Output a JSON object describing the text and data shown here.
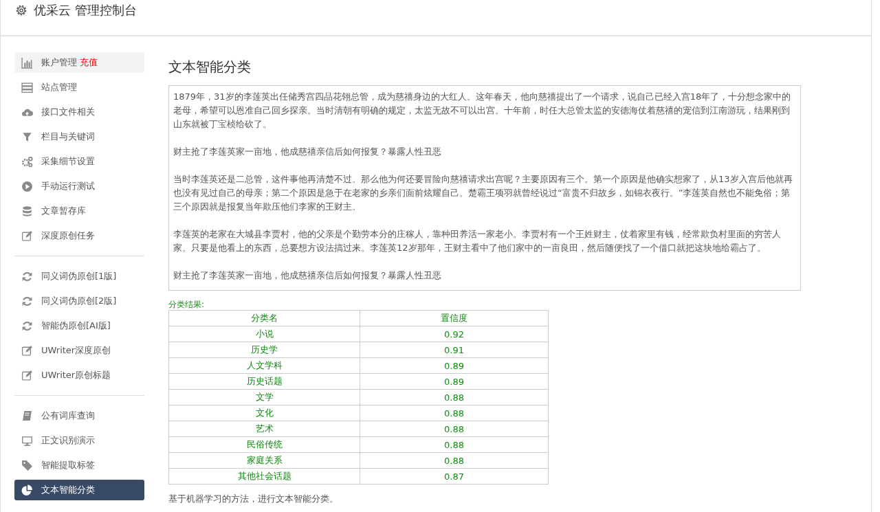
{
  "header": {
    "title": "优采云 管理控制台"
  },
  "sidebar": {
    "groups": [
      {
        "items": [
          {
            "label": "账户管理",
            "badge": "充值",
            "highlighted": true,
            "selected": false
          },
          {
            "label": "站点管理",
            "highlighted": false,
            "selected": false
          },
          {
            "label": "接口文件相关",
            "highlighted": false,
            "selected": false
          },
          {
            "label": "栏目与关键词",
            "highlighted": false,
            "selected": false
          },
          {
            "label": "采集细节设置",
            "highlighted": false,
            "selected": false
          },
          {
            "label": "手动运行测试",
            "highlighted": false,
            "selected": false
          },
          {
            "label": "文章暂存库",
            "highlighted": false,
            "selected": false
          },
          {
            "label": "深度原创任务",
            "highlighted": false,
            "selected": false
          }
        ]
      },
      {
        "items": [
          {
            "label": "同义词伪原创[1版]",
            "highlighted": false,
            "selected": false
          },
          {
            "label": "同义词伪原创[2版]",
            "highlighted": false,
            "selected": false
          },
          {
            "label": "智能伪原创[AI版]",
            "highlighted": false,
            "selected": false
          },
          {
            "label": "UWriter深度原创",
            "highlighted": false,
            "selected": false
          },
          {
            "label": "UWriter原创标题",
            "highlighted": false,
            "selected": false
          }
        ]
      },
      {
        "items": [
          {
            "label": "公有词库查询",
            "highlighted": false,
            "selected": false
          },
          {
            "label": "正文识别演示",
            "highlighted": false,
            "selected": false
          },
          {
            "label": "智能提取标签",
            "highlighted": false,
            "selected": false
          },
          {
            "label": "文本智能分类",
            "highlighted": false,
            "selected": true
          }
        ]
      }
    ]
  },
  "main": {
    "title": "文本智能分类",
    "text_input": {
      "paragraphs": [
        "1879年，31岁的李莲英出任储秀宫四品花翎总管，成为慈禧身边的大红人。这年春天，他向慈禧提出了一个请求，说自己已经入宫18年了，十分想念家中的老母，希望可以恩准自己回乡探亲。当时清朝有明确的规定，太监无故不可以出宫。十年前，时任大总管太监的安德海仗着慈禧的宠信到江南游玩，结果刚到山东就被丁宝桢给砍了。",
        "财主抢了李莲英家一亩地，他成慈禧亲信后如何报复？暴露人性丑恶",
        "当时李莲英还是二总管，这件事他再清楚不过。那么他为何还要冒险向慈禧请求出宫呢？主要原因有三个。第一个原因是他确实想家了，从13岁入宫后他就再也没有见过自己的母亲；第二个原因是急于在老家的乡亲们面前炫耀自己。楚霸王项羽就曾经说过“富贵不归故乡，如锦衣夜行。”李莲英自然也不能免俗；第三个原因就是报复当年欺压他们李家的王财主。",
        "李莲英的老家在大城县李贾村，他的父亲是个勤劳本分的庄稼人，靠种田养活一家老小。李贾村有一个王姓财主，仗着家里有钱，经常欺负村里面的穷苦人家。只要是他看上的东西，总要想方设法搞过来。李莲英12岁那年，王财主看中了他们家中的一亩良田，然后随便找了一个借口就把这块地给霸占了。",
        "财主抢了李莲英家一亩地，他成慈禧亲信后如何报复？暴露人性丑恶"
      ]
    },
    "result_label": "分类结果:",
    "table": {
      "columns": [
        "分类名",
        "置信度"
      ],
      "rows": [
        [
          "小说",
          "0.92"
        ],
        [
          "历史学",
          "0.91"
        ],
        [
          "人文学科",
          "0.89"
        ],
        [
          "历史话题",
          "0.89"
        ],
        [
          "文学",
          "0.88"
        ],
        [
          "文化",
          "0.88"
        ],
        [
          "艺术",
          "0.88"
        ],
        [
          "民俗传统",
          "0.88"
        ],
        [
          "家庭关系",
          "0.88"
        ],
        [
          "其他社会话题",
          "0.87"
        ]
      ]
    },
    "footer_note": "基于机器学习的方法，进行文本智能分类。"
  }
}
